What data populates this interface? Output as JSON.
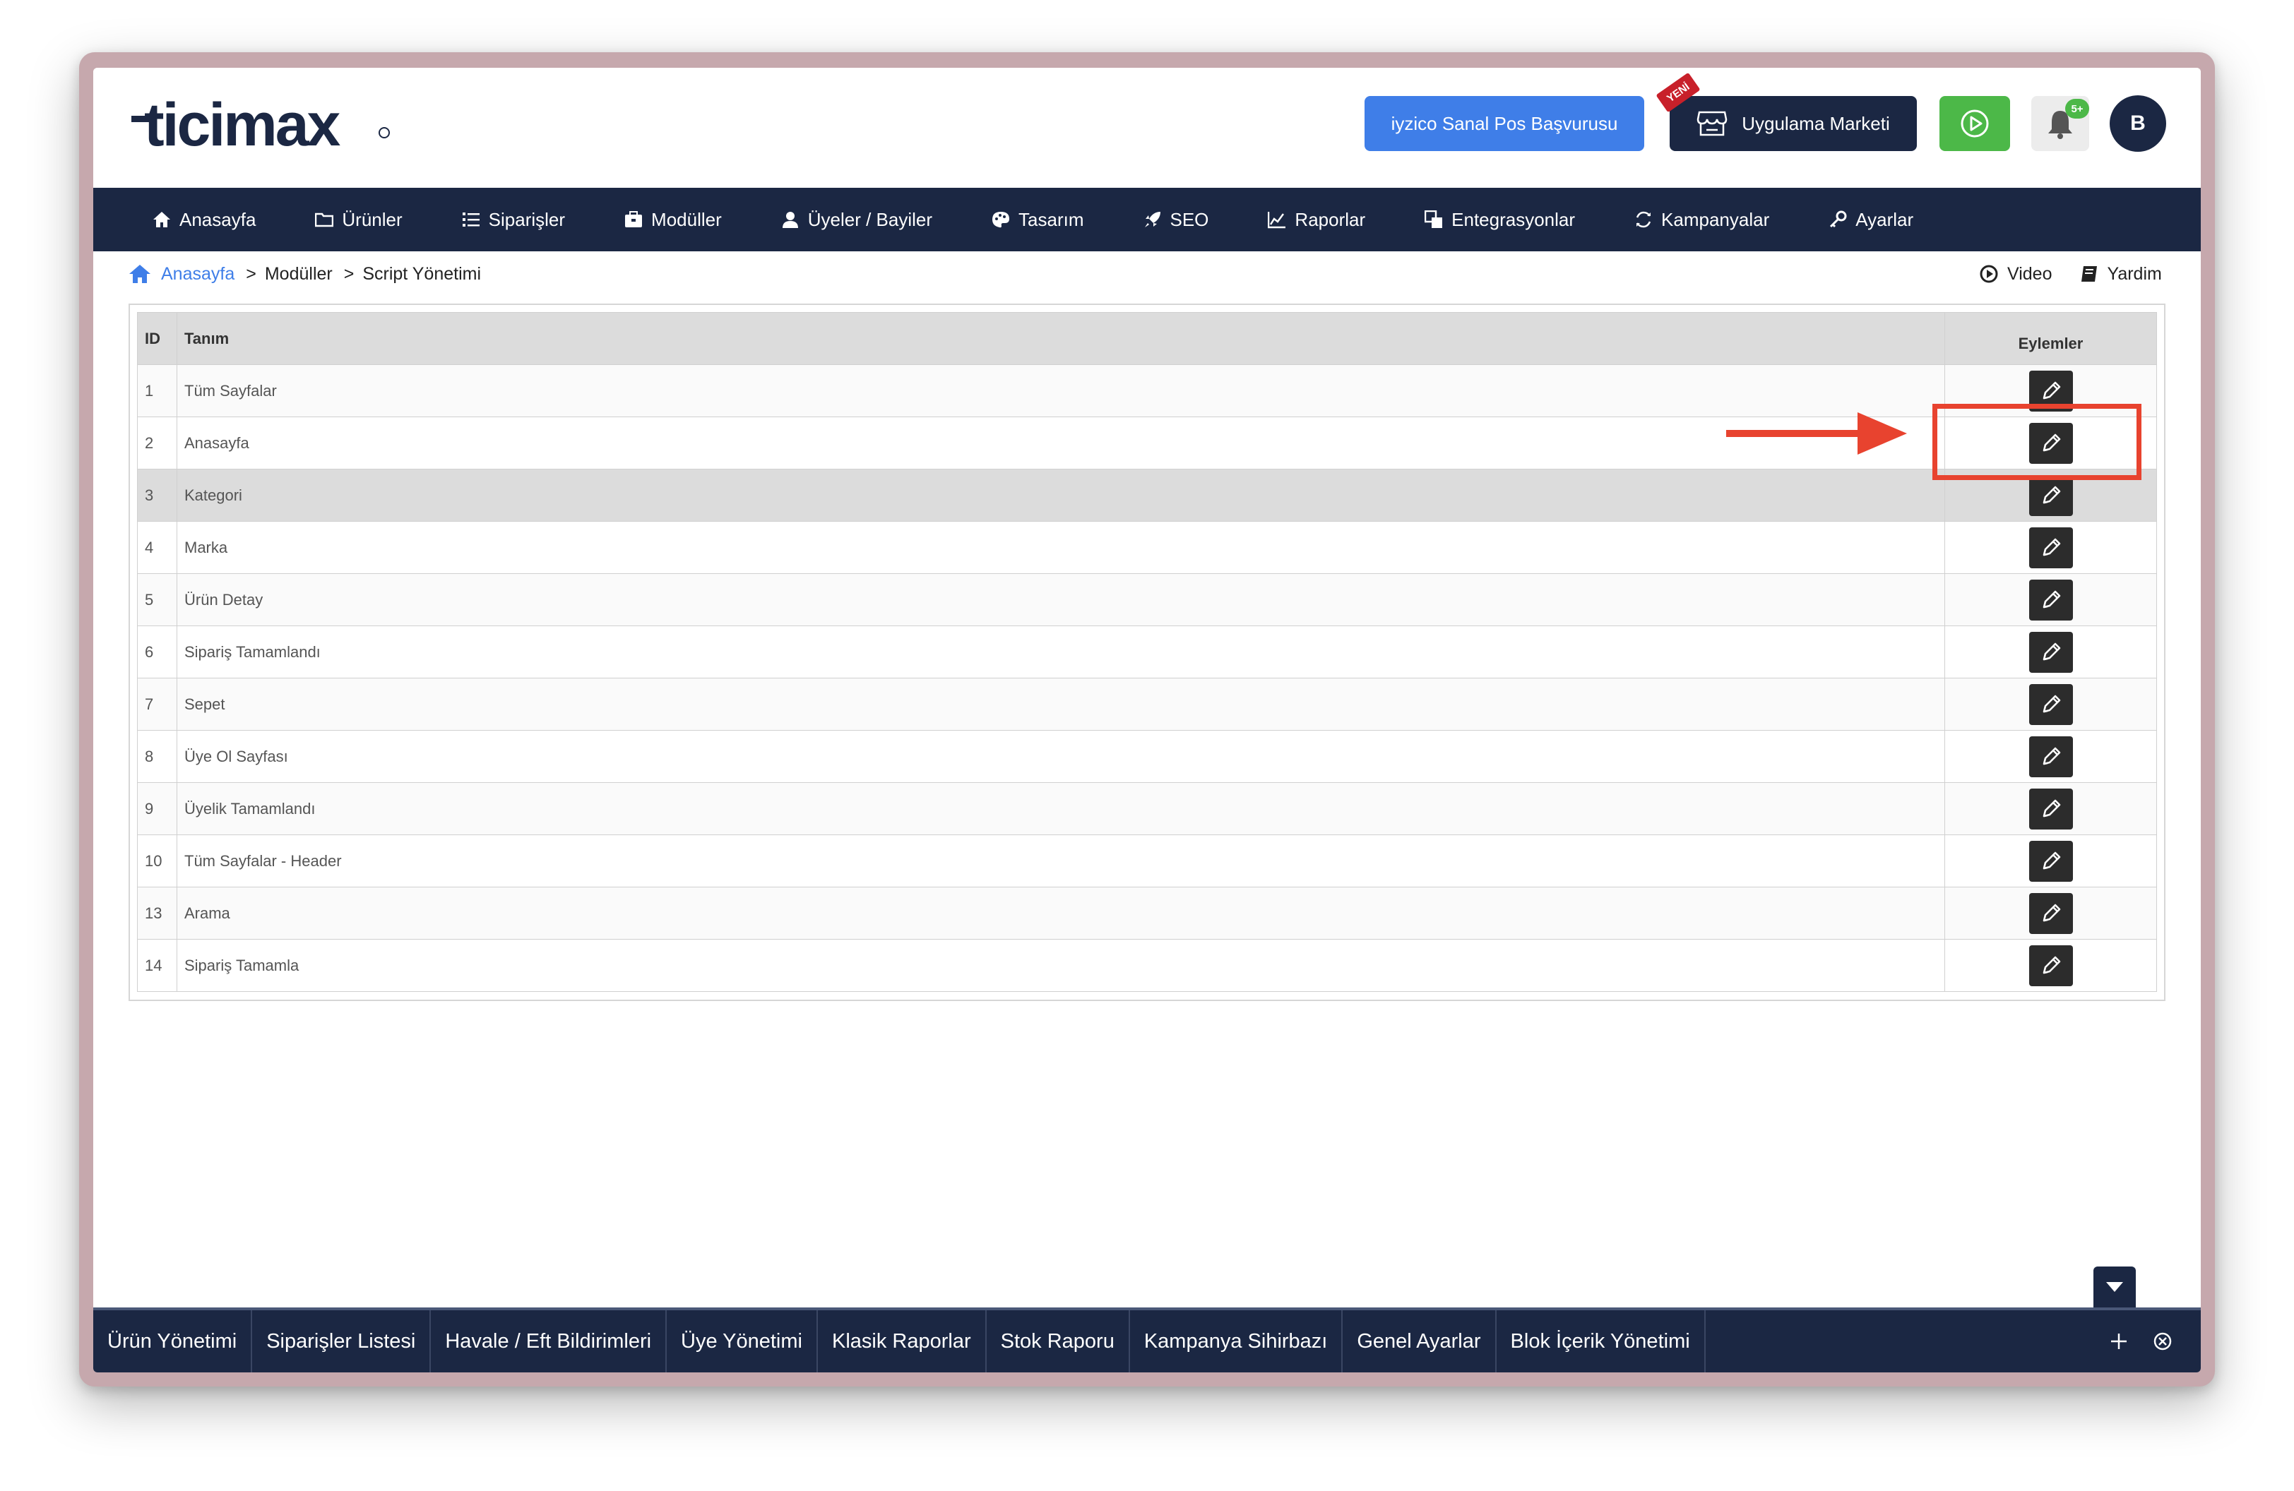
{
  "brand": {
    "logo_text": "ticimax"
  },
  "header": {
    "iyzico_button": "iyzico Sanal Pos Başvurusu",
    "market_button": "Uygulama Marketi",
    "new_ribbon": "YENİ",
    "notification_badge": "5+",
    "avatar_initial": "B"
  },
  "nav": {
    "items": [
      {
        "label": "Anasayfa",
        "icon": "home-icon"
      },
      {
        "label": "Ürünler",
        "icon": "folder-icon"
      },
      {
        "label": "Siparişler",
        "icon": "list-icon"
      },
      {
        "label": "Modüller",
        "icon": "box-icon"
      },
      {
        "label": "Üyeler / Bayiler",
        "icon": "users-icon"
      },
      {
        "label": "Tasarım",
        "icon": "palette-icon"
      },
      {
        "label": "SEO",
        "icon": "rocket-icon"
      },
      {
        "label": "Raporlar",
        "icon": "chart-icon"
      },
      {
        "label": "Entegrasyonlar",
        "icon": "integration-icon"
      },
      {
        "label": "Kampanyalar",
        "icon": "refresh-icon"
      },
      {
        "label": "Ayarlar",
        "icon": "key-icon"
      }
    ]
  },
  "breadcrumb": {
    "home": "Anasayfa",
    "sep1": ">",
    "modules": "Modüller",
    "sep2": ">",
    "current": "Script Yönetimi"
  },
  "top_links": {
    "video": "Video",
    "help": "Yardim"
  },
  "table": {
    "headers": {
      "id": "ID",
      "name": "Tanım",
      "actions": "Eylemler"
    },
    "rows": [
      {
        "id": "1",
        "name": "Tüm Sayfalar"
      },
      {
        "id": "2",
        "name": "Anasayfa"
      },
      {
        "id": "3",
        "name": "Kategori"
      },
      {
        "id": "4",
        "name": "Marka"
      },
      {
        "id": "5",
        "name": "Ürün Detay"
      },
      {
        "id": "6",
        "name": "Sipariş Tamamlandı"
      },
      {
        "id": "7",
        "name": "Sepet"
      },
      {
        "id": "8",
        "name": "Üye Ol Sayfası"
      },
      {
        "id": "9",
        "name": "Üyelik Tamamlandı"
      },
      {
        "id": "10",
        "name": "Tüm Sayfalar - Header"
      },
      {
        "id": "13",
        "name": "Arama"
      },
      {
        "id": "14",
        "name": "Sipariş Tamamla"
      }
    ]
  },
  "bottom_bar": {
    "tabs": [
      "Ürün Yönetimi",
      "Siparişler Listesi",
      "Havale / Eft Bildirimleri",
      "Üye Yönetimi",
      "Klasik Raporlar",
      "Stok Raporu",
      "Kampanya Sihirbazı",
      "Genel Ayarlar",
      "Blok İçerik Yönetimi"
    ]
  },
  "colors": {
    "navy": "#1b2743",
    "blue": "#3f7ee8",
    "green": "#4cb848",
    "annotation_red": "#e8432f"
  }
}
